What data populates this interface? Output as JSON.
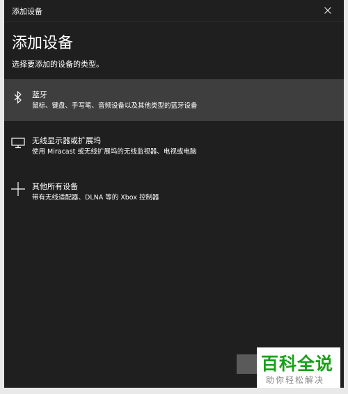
{
  "window": {
    "title": "添加设备",
    "heading": "添加设备",
    "subheading": "选择要添加的设备的类型。"
  },
  "options": [
    {
      "icon": "bluetooth-icon",
      "title": "蓝牙",
      "description": "鼠标、键盘、手写笔、音频设备以及其他类型的蓝牙设备",
      "selected": true
    },
    {
      "icon": "monitor-icon",
      "title": "无线显示器或扩展坞",
      "description": "使用 Miracast 或无线扩展坞的无线监视器、电视或电脑",
      "selected": false
    },
    {
      "icon": "plus-icon",
      "title": "其他所有设备",
      "description": "带有无线适配器、DLNA 等的 Xbox 控制器",
      "selected": false
    }
  ],
  "watermark": {
    "brand": "百科全说",
    "tagline": "助你轻松解决"
  },
  "colors": {
    "window_bg": "#1f1f1f",
    "selected_bg": "#3e3e3e",
    "text": "#ffffff",
    "watermark_green": "#1aa01a"
  }
}
